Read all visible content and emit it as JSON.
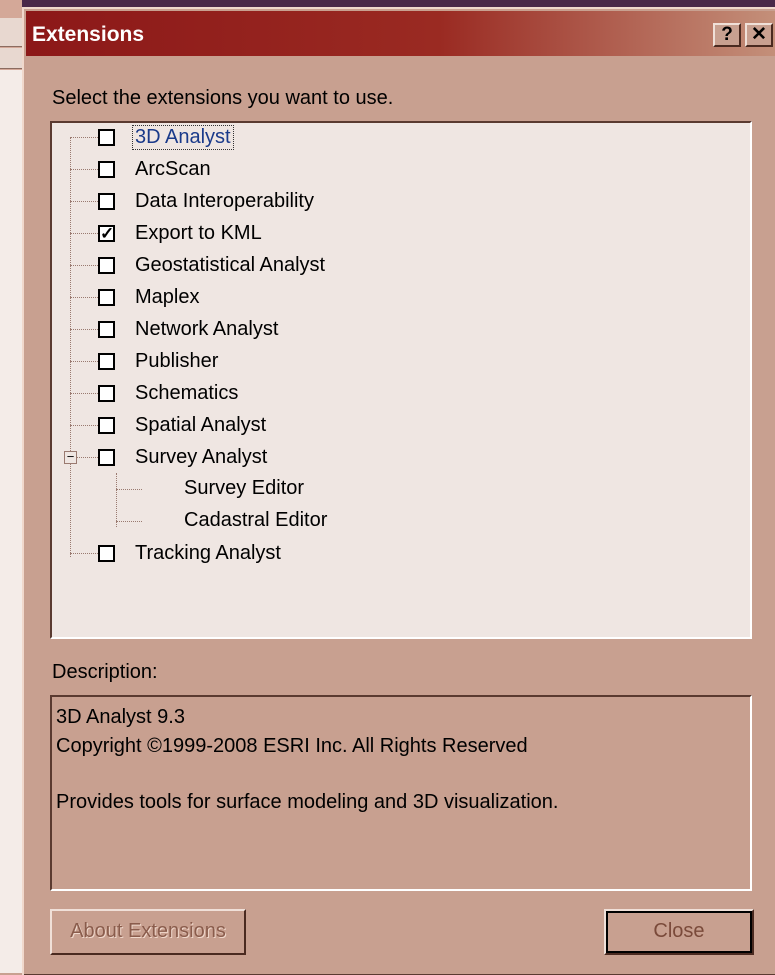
{
  "window": {
    "title": "Extensions",
    "help_label": "?",
    "close_label": "✕"
  },
  "instruction": "Select the extensions you want to use.",
  "extensions": [
    {
      "label": "3D Analyst",
      "checked": false,
      "selected": true
    },
    {
      "label": "ArcScan",
      "checked": false
    },
    {
      "label": "Data Interoperability",
      "checked": false
    },
    {
      "label": "Export to KML",
      "checked": true
    },
    {
      "label": "Geostatistical Analyst",
      "checked": false
    },
    {
      "label": "Maplex",
      "checked": false
    },
    {
      "label": "Network Analyst",
      "checked": false
    },
    {
      "label": "Publisher",
      "checked": false
    },
    {
      "label": "Schematics",
      "checked": false
    },
    {
      "label": "Spatial Analyst",
      "checked": false
    },
    {
      "label": "Survey Analyst",
      "checked": false,
      "expanded": true,
      "children": [
        {
          "label": "Survey Editor"
        },
        {
          "label": "Cadastral Editor"
        }
      ]
    },
    {
      "label": "Tracking Analyst",
      "checked": false
    }
  ],
  "description": {
    "label": "Description:",
    "line1": "3D Analyst 9.3",
    "line2": "Copyright ©1999-2008 ESRI Inc. All Rights Reserved",
    "line3": "Provides tools for surface modeling and 3D visualization."
  },
  "buttons": {
    "about_label": "About Extensions",
    "close_label": "Close"
  },
  "colors": {
    "titlebar": "#8c1818",
    "dialog_bg": "#c8a090",
    "list_bg": "#efe6e2"
  }
}
